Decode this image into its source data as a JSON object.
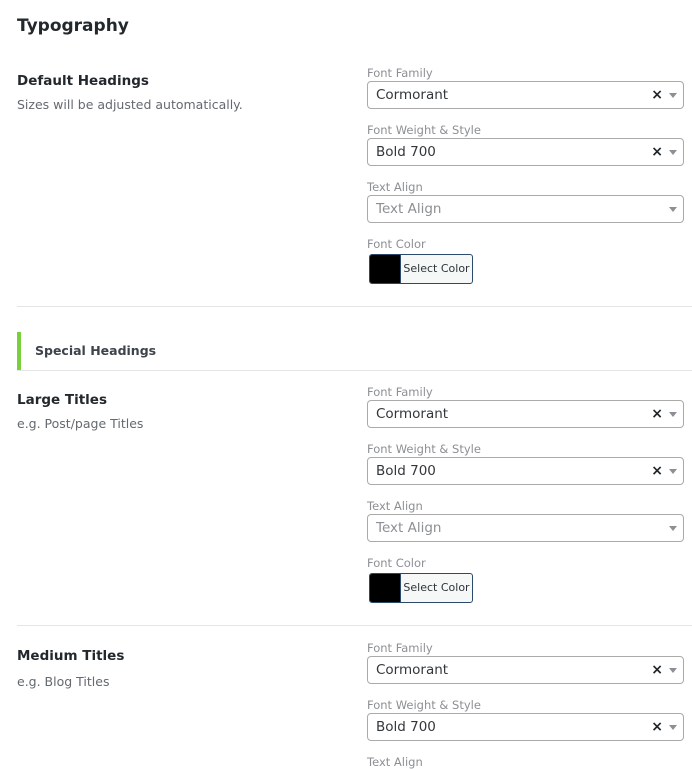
{
  "page": {
    "title": "Typography"
  },
  "labels": {
    "font_family": "Font Family",
    "font_weight": "Font Weight & Style",
    "text_align": "Text Align",
    "font_color": "Font Color",
    "text_align_placeholder": "Text Align",
    "select_color": "Select Color",
    "clear": "×"
  },
  "default_headings": {
    "title": "Default Headings",
    "description": "Sizes will be adjusted automatically.",
    "font_family": "Cormorant",
    "font_weight": "Bold 700",
    "text_align": "",
    "font_color": "#000000"
  },
  "special_headings": {
    "title": "Special Headings",
    "accent_color": "#7ad03a"
  },
  "large_titles": {
    "title": "Large Titles",
    "description": "e.g. Post/page Titles",
    "font_family": "Cormorant",
    "font_weight": "Bold 700",
    "text_align": "",
    "font_color": "#000000"
  },
  "medium_titles": {
    "title": "Medium Titles",
    "description": "e.g. Blog Titles",
    "font_family": "Cormorant",
    "font_weight": "Bold 700"
  }
}
